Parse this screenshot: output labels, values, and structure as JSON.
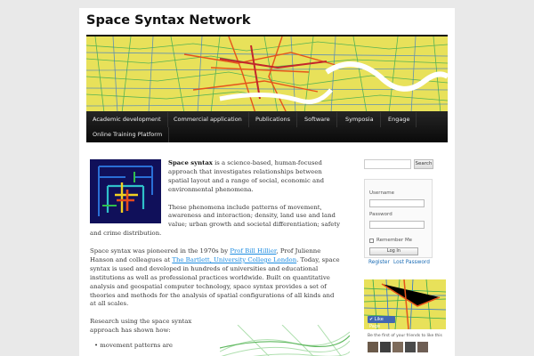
{
  "site": {
    "title": "Space Syntax Network"
  },
  "nav": {
    "items": [
      {
        "label": "Academic development"
      },
      {
        "label": "Commercial application"
      },
      {
        "label": "Publications"
      },
      {
        "label": "Software"
      },
      {
        "label": "Symposia"
      },
      {
        "label": "Engage"
      },
      {
        "label": "Online Training Platform"
      }
    ]
  },
  "content": {
    "intro_strong": "Space syntax",
    "intro_rest": " is a science-based, human-focused approach that investigates relationships between spatial layout and a range of social, economic and environmental phenomena.",
    "phenomena": "These phenomena include patterns of movement, awareness and interaction; density, land use and land value; urban growth and societal differentiation; safety and crime distribution.",
    "p3_a": "Space syntax was pioneered in the 1970s by ",
    "p3_link1": "Prof Bill Hillier",
    "p3_b": ", Prof Julienne Hanson and colleagues at ",
    "p3_link2": "The Bartlett, University College London",
    "p3_c": ". Today, space syntax is used and developed in hundreds of universities and educational institutions as well as professional practices worldwide. Built on quantitative analysis and geospatial computer technology, space syntax provides a set of theories and methods for the analysis of spatial configurations of all kinds and at all scales.",
    "research": "Research using the space syntax approach has shown how:",
    "bullet1": "movement patterns are"
  },
  "sidebar": {
    "search_button": "Search",
    "username_label": "Username",
    "password_label": "Password",
    "remember_label": "Remember Me",
    "login_button": "Log In",
    "register_link": "Register",
    "lost_password_link": "Lost Password",
    "like_label": "Like Page",
    "fb_text": "Be the first of your friends to like this"
  },
  "icons": {
    "like": "thumbs-up-icon",
    "checkbox": "checkbox-icon"
  }
}
